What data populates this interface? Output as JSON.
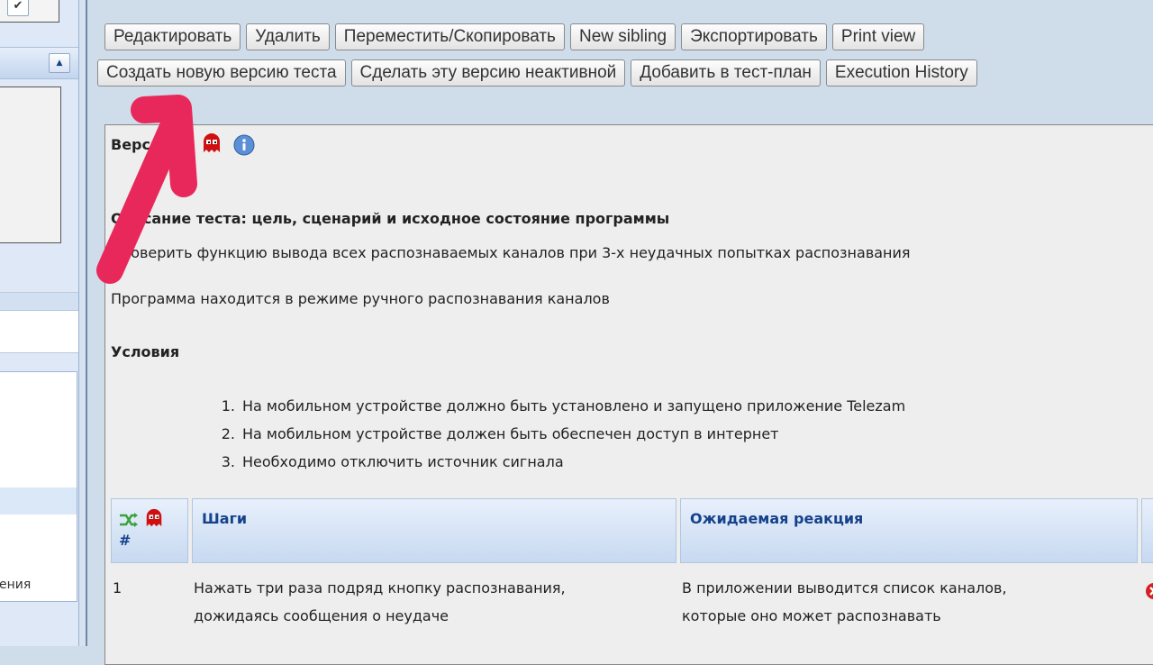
{
  "left_panel": {
    "checkbox_mark": "✔",
    "collapse_glyph": "▲",
    "list_partial_text": "ения"
  },
  "toolbar": {
    "row1": [
      "Редактировать",
      "Удалить",
      "Переместить/Скопировать",
      "New sibling",
      "Экспортировать",
      "Print view"
    ],
    "row2": [
      "Создать новую версию теста",
      "Сделать эту версию неактивной",
      "Добавить в тест-план",
      "Execution History"
    ]
  },
  "testcase": {
    "version_label": "Версия",
    "summary_heading": "Описание теста: цель, сценарий и исходное состояние программы",
    "summary_text": "Проверить функцию вывода всех распознаваемых каналов при 3-х неудачных попытках распознавания",
    "mode_text": "Программа находится в режиме ручного распознавания каналов",
    "preconditions_heading": "Условия",
    "preconditions": [
      "На мобильном устройстве должно быть установлено и запущено приложение Telezam",
      "На мобильном устройстве должен быть обеспечен доступ в интернет",
      "Необходимо отключить источник сигнала"
    ]
  },
  "steps_table": {
    "num_header": "#",
    "steps_header": "Шаги",
    "expected_header": "Ожидаемая реакция",
    "rows": [
      {
        "num": "1",
        "step_line1": "Нажать три раза подряд кнопку распознавания,",
        "step_line2": "дожидаясь сообщения о неудаче",
        "expected_line1": "В приложении выводится список каналов,",
        "expected_line2": "которые оно может распознавать"
      }
    ]
  },
  "colors": {
    "accent_blue": "#15428b",
    "ghost_red": "#d01010",
    "annotation_pink": "#e8285a",
    "info_blue": "#5b8fd6"
  }
}
